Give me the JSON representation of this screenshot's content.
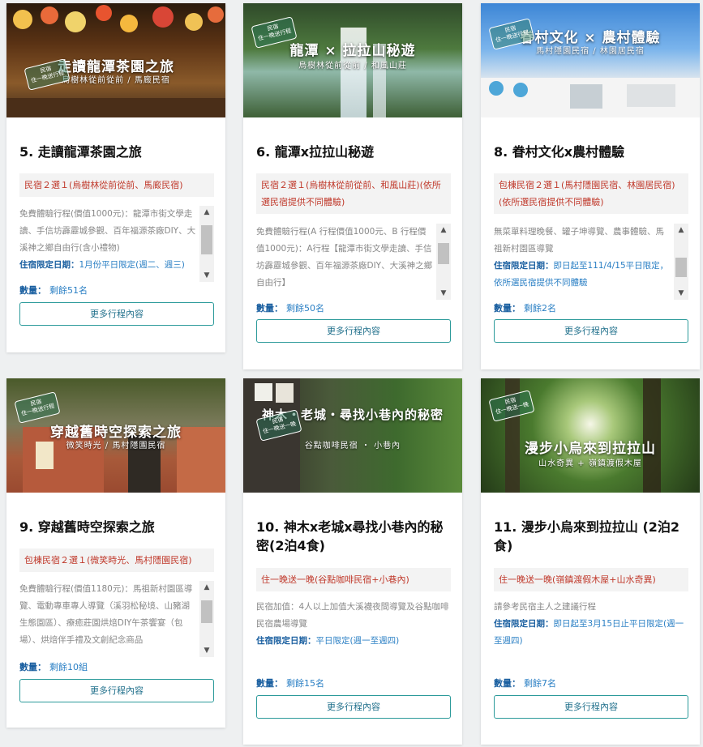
{
  "tours": [
    {
      "overlay_title": "走讀龍潭茶園之旅",
      "overlay_sub": "烏樹林從前從前 / 馬廄民宿",
      "stamp_l1": "民宿",
      "stamp_l2": "住一晚送行程",
      "title": "5. 走讀龍潭茶園之旅",
      "stay": "民宿２選１(烏樹林從前從前、馬廄民宿)",
      "desc": "免費體驗行程(價值1000元)：龍潭市街文學走讀、手信坊霹靂城參觀、百年福源茶廠DIY、大溪神之鄉自由行(含小禮物)",
      "limit_label": "住宿限定日期：",
      "limit_value": "1月份平日限定(週二、週三)",
      "qty_label": "數量：",
      "qty_value": "剩餘51名",
      "button": "更多行程內容"
    },
    {
      "overlay_title": "龍潭 × 拉拉山秘遊",
      "overlay_sub": "烏樹林從前從前 / 和風山莊",
      "stamp_l1": "民宿",
      "stamp_l2": "住一晚送行程",
      "title": "6. 龍潭x拉拉山秘遊",
      "stay": "民宿２選１(烏樹林從前從前、和風山莊)(依所選民宿提供不同體驗)",
      "desc": "免費體驗行程(A 行程價值1000元、B 行程價值1000元)：A行程【龍潭市街文學走讀、手信坊霹靂城參觀、百年福源茶廠DIY、大溪神之鄉自由行】",
      "limit_label": "",
      "limit_value": "",
      "qty_label": "數量：",
      "qty_value": "剩餘50名",
      "button": "更多行程內容"
    },
    {
      "overlay_title": "眷村文化 × 農村體驗",
      "overlay_sub": "馬村隱園民宿 / 林園居民宿",
      "stamp_l1": "民宿",
      "stamp_l2": "住一晚送行程",
      "title": "8. 眷村文化x農村體驗",
      "stay": "包棟民宿２選１(馬村隱園民宿、林園居民宿) (依所選民宿提供不同體驗)",
      "desc": "無菜單料理晚餐、罐子坤導覽、農事體驗、馬祖新村園區導覽",
      "limit_label": "住宿限定日期：",
      "limit_value": "即日起至111/4/15平日限定，依所選民宿提供不同體驗",
      "qty_label": "數量：",
      "qty_value": "剩餘2名",
      "button": "更多行程內容"
    },
    {
      "overlay_title": "穿越舊時空探索之旅",
      "overlay_sub": "微笑時光 / 馬村隱園民宿",
      "stamp_l1": "民宿",
      "stamp_l2": "住一晚送行程",
      "title": "9. 穿越舊時空探索之旅",
      "stay": "包棟民宿２選１(微笑時光、馬村隱園民宿)",
      "desc": "免費體驗行程(價值1180元)：馬祖新村園區導覽、電動專車專人導覽（溪羽松秘境、山豬湖生態園區）、療癒莊園烘焙DIY午茶饗宴（包場）、烘焙伴手禮及文創紀念商品",
      "limit_label": "",
      "limit_value": "",
      "qty_label": "數量：",
      "qty_value": "剩餘10組",
      "button": "更多行程內容"
    },
    {
      "overlay_title": "神木・老城・尋找小巷內的秘密",
      "overlay_sub": "谷點咖啡民宿 ・ 小巷內",
      "stamp_l1": "民宿",
      "stamp_l2": "住一晚送一晚",
      "title": "10. 神木x老城x尋找小巷內的秘密(2泊4食)",
      "stay": "住一晚送一晚(谷點咖啡民宿+小巷內)",
      "desc": "民宿加值：4人以上加值大溪襪夜間導覽及谷點咖啡民宿農場導覽",
      "limit_label": "住宿限定日期：",
      "limit_value": "平日限定(週一至週四)",
      "qty_label": "數量：",
      "qty_value": "剩餘15名",
      "button": "更多行程內容"
    },
    {
      "overlay_title": "漫步小烏來到拉拉山",
      "overlay_sub": "山水奇異 + 嶺鎮渡假木屋",
      "stamp_l1": "民宿",
      "stamp_l2": "住一晚送一晚",
      "title": "11. 漫步小烏來到拉拉山 (2泊2食)",
      "stay": "住一晚送一晚(嶺鎮渡假木屋+山水奇異)",
      "desc": "請參考民宿主人之建議行程",
      "limit_label": "住宿限定日期：",
      "limit_value": "即日起至3月15日止平日限定(週一至週四)",
      "qty_label": "數量：",
      "qty_value": "剩餘7名",
      "button": "更多行程內容"
    }
  ]
}
